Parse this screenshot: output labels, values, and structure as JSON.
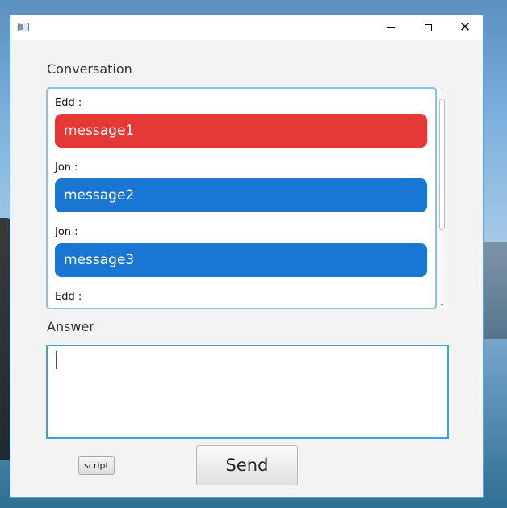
{
  "window": {
    "title": "",
    "icon": "app-window-icon"
  },
  "titlebar": {
    "minimize_icon": "minimize-icon",
    "maximize_icon": "maximize-icon",
    "close_icon": "close-icon",
    "close_glyph": "✕"
  },
  "conversation": {
    "label": "Conversation",
    "messages": [
      {
        "sender": "Edd :",
        "text": "message1",
        "color": "#e53935"
      },
      {
        "sender": "Jon :",
        "text": "message2",
        "color": "#1976d2"
      },
      {
        "sender": "Jon :",
        "text": "message3",
        "color": "#1976d2"
      },
      {
        "sender": "Edd :",
        "text": "",
        "color": "#e53935"
      }
    ]
  },
  "scrollbar": {
    "up_glyph": "⌃",
    "down_glyph": "⌄"
  },
  "answer": {
    "label": "Answer",
    "value": ""
  },
  "buttons": {
    "script_label": "script",
    "send_label": "Send"
  },
  "colors": {
    "accent": "#36a3de",
    "edd": "#e53935",
    "jon": "#1976d2"
  }
}
